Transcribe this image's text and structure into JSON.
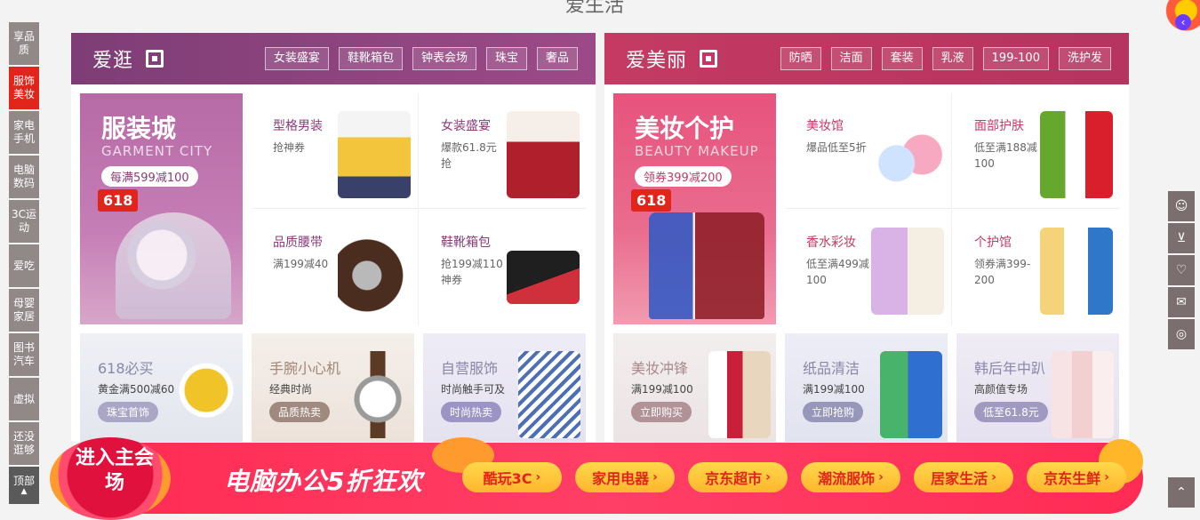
{
  "top": {
    "section_title": "爱生活"
  },
  "left_nav": {
    "items": [
      "享品质",
      "服饰美妆",
      "家电手机",
      "电脑数码",
      "3C运动",
      "爱吃",
      "母婴家居",
      "图书汽车",
      "虚拟",
      "还没逛够"
    ],
    "top_label": "顶部",
    "active_index": 1
  },
  "panels": [
    {
      "title": "爱逛",
      "tags": [
        "女装盛宴",
        "鞋靴箱包",
        "钟表会场",
        "珠宝",
        "奢品"
      ],
      "hero": {
        "title": "服装城",
        "subtitle": "GARMENT CITY",
        "pill": "每满599减100",
        "badge": "618"
      },
      "cells": [
        {
          "title": "型格男装",
          "desc": "抢神券"
        },
        {
          "title": "女装盛宴",
          "desc": "爆款61.8元抢"
        },
        {
          "title": "品质腰带",
          "desc": "满199减40"
        },
        {
          "title": "鞋靴箱包",
          "desc": "抢199减110神券"
        }
      ],
      "cards": [
        {
          "title": "618必买",
          "desc": "黄金满500减60",
          "button": "珠宝首饰"
        },
        {
          "title": "手腕小心机",
          "desc": "经典时尚",
          "button": "品质热卖"
        },
        {
          "title": "自营服饰",
          "desc": "时尚触手可及",
          "button": "时尚热卖"
        }
      ]
    },
    {
      "title": "爱美丽",
      "tags": [
        "防晒",
        "洁面",
        "套装",
        "乳液",
        "199-100",
        "洗护发"
      ],
      "hero": {
        "title": "美妆个护",
        "subtitle": "BEAUTY MAKEUP",
        "pill": "领券399减200",
        "badge": "618"
      },
      "cells": [
        {
          "title": "美妆馆",
          "desc": "爆品低至5折"
        },
        {
          "title": "面部护肤",
          "desc": "低至满188减100"
        },
        {
          "title": "香水彩妆",
          "desc": "低至满499减100"
        },
        {
          "title": "个护馆",
          "desc": "领券满399-200"
        }
      ],
      "cards": [
        {
          "title": "美妆冲锋",
          "desc": "满199减100",
          "button": "立即购买"
        },
        {
          "title": "纸品清洁",
          "desc": "满199减100",
          "button": "立即抢购"
        },
        {
          "title": "韩后年中趴",
          "desc": "高颜值专场",
          "button": "低至61.8元"
        }
      ]
    }
  ],
  "banner": {
    "enter_label": "进入主会场",
    "slogan": "电脑办公5折狂欢",
    "links": [
      "酷玩3C",
      "家用电器",
      "京东超市",
      "潮流服饰",
      "居家生活",
      "京东生鲜"
    ]
  },
  "right_tools": [
    "user-icon",
    "cart-icon",
    "heart-icon",
    "message-icon",
    "service-icon"
  ],
  "colors": {
    "active": "#e1251b",
    "left_panel": "#8a3c7a",
    "right_panel": "#c43a63",
    "banner": "#ff2b54"
  }
}
